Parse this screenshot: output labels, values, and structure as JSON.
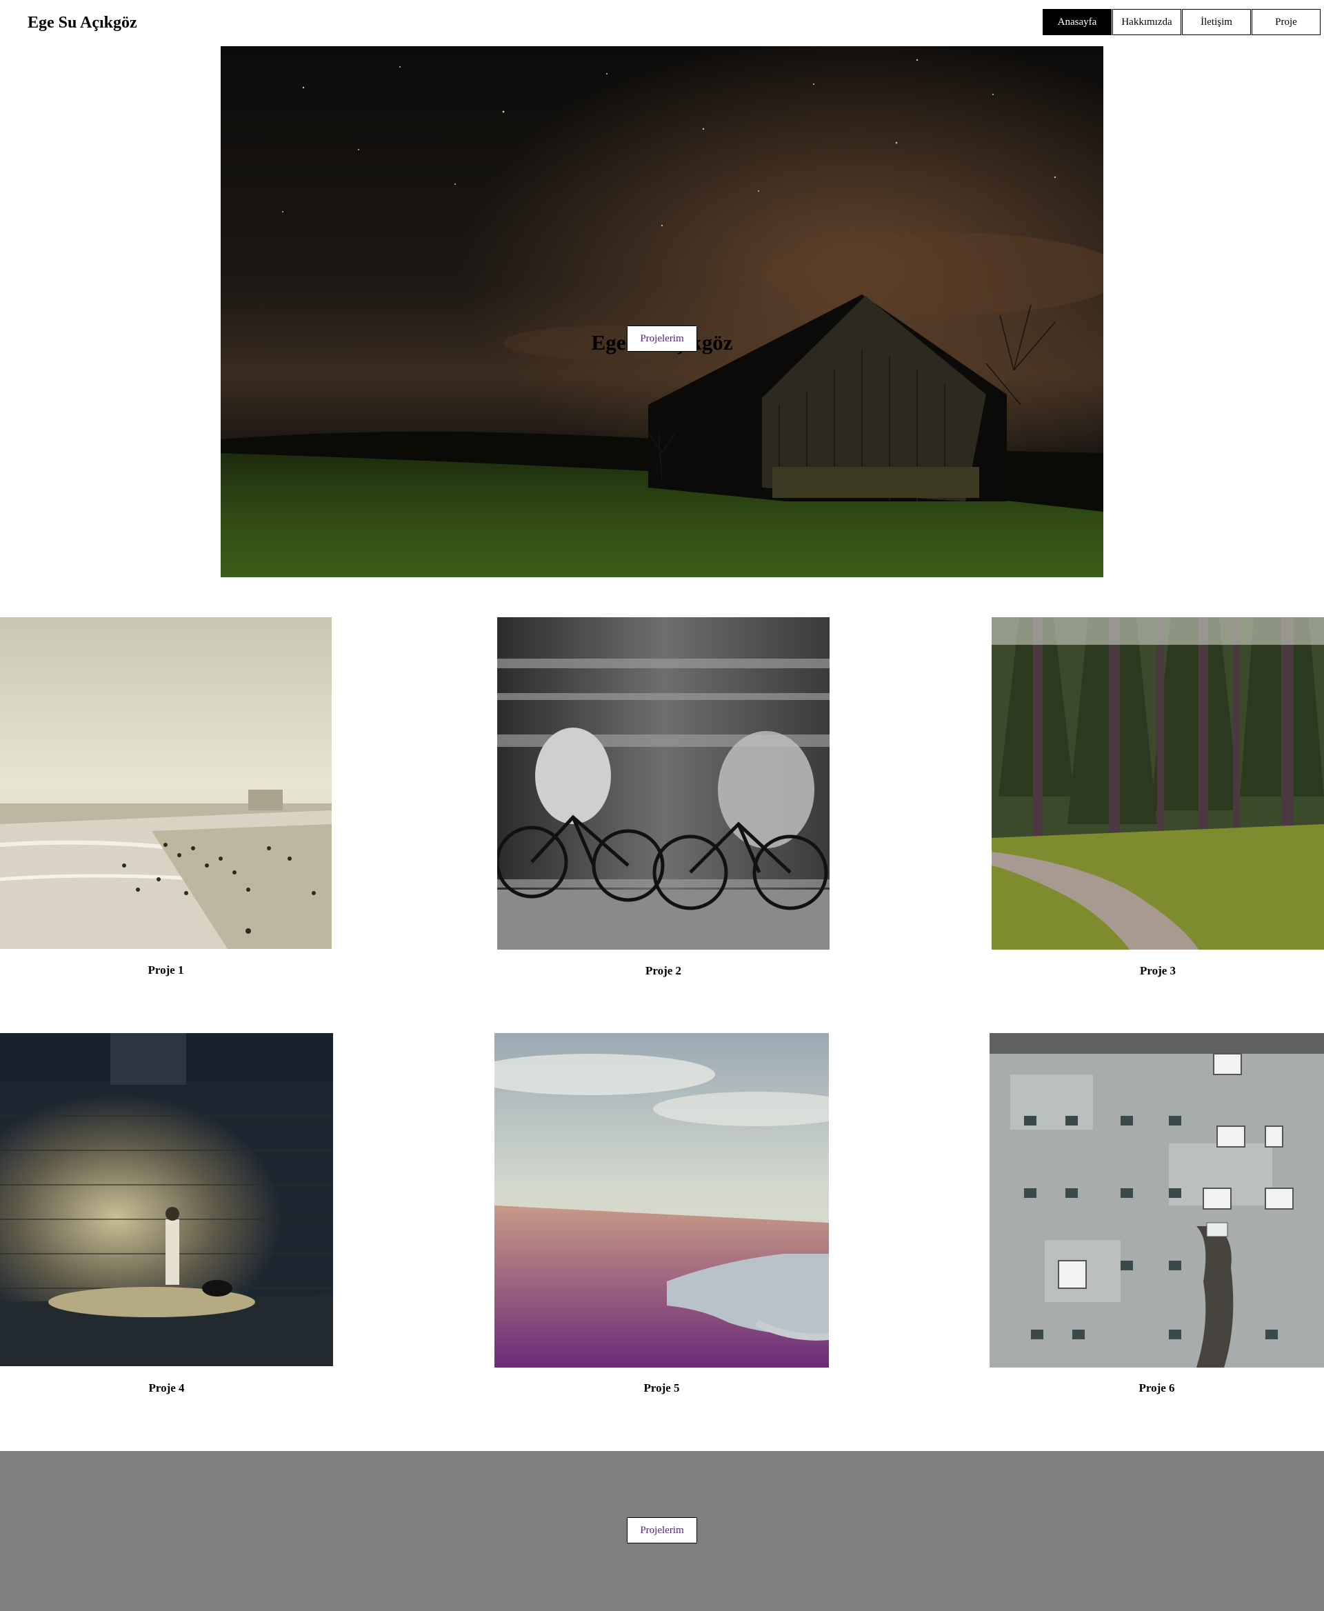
{
  "header": {
    "site_title": "Ege Su Açıkgöz",
    "nav": [
      {
        "label": "Anasayfa",
        "active": true
      },
      {
        "label": "Hakkımızda",
        "active": false
      },
      {
        "label": "İletişim",
        "active": false
      },
      {
        "label": "Proje",
        "active": false
      }
    ]
  },
  "hero": {
    "title": "Ege Su Açıkgöz",
    "button_label": "Projelerim"
  },
  "projects": [
    {
      "caption": "Proje 1"
    },
    {
      "caption": "Proje 2"
    },
    {
      "caption": "Proje 3"
    },
    {
      "caption": "Proje 4"
    },
    {
      "caption": "Proje 5"
    },
    {
      "caption": "Proje 6"
    }
  ],
  "footer": {
    "button_label": "Projelerim",
    "background": "#7f7f7f"
  },
  "colors": {
    "link": "#4b1e8a",
    "nav_active_bg": "#000000"
  }
}
